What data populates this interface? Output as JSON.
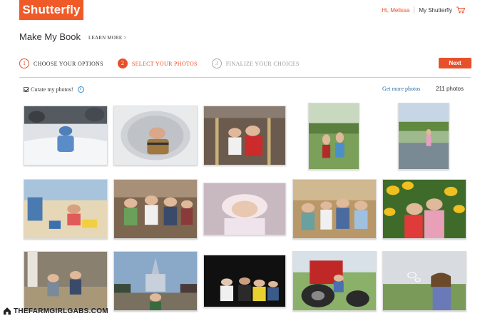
{
  "header": {
    "logo_text": "Shutterfly",
    "greeting": "Hi, Melissa",
    "my_account": "My Shutterfly",
    "cart_icon": "cart-icon",
    "accent_color": "#e8502a"
  },
  "page": {
    "title": "Make My Book",
    "learn_more": "LEARN MORE >"
  },
  "steps": [
    {
      "number": "1",
      "label": "CHOOSE YOUR OPTIONS",
      "state": "done"
    },
    {
      "number": "2",
      "label": "SELECT YOUR PHOTOS",
      "state": "active"
    },
    {
      "number": "3",
      "label": "FINALIZE YOUR CHOICES",
      "state": "future"
    }
  ],
  "next_label": "Next",
  "toolbar": {
    "curate_label": "Curate my photos!",
    "curate_checked": true,
    "info_icon": "i",
    "get_more": "Get more photos",
    "photo_count": "211 photos"
  },
  "photos": [
    {
      "name": "child-in-snow",
      "scene": "snow"
    },
    {
      "name": "child-in-dryer",
      "scene": "dryer"
    },
    {
      "name": "family-at-carousel",
      "scene": "carousel"
    },
    {
      "name": "kids-on-grass",
      "scene": "grass"
    },
    {
      "name": "child-by-pond",
      "scene": "pond"
    },
    {
      "name": "kids-at-beach",
      "scene": "beach"
    },
    {
      "name": "family-indoor-group",
      "scene": "indoor"
    },
    {
      "name": "sleeping-baby",
      "scene": "baby"
    },
    {
      "name": "family-group-living-room",
      "scene": "family"
    },
    {
      "name": "girls-in-sunflowers",
      "scene": "sunflowers"
    },
    {
      "name": "boys-on-porch",
      "scene": "porch"
    },
    {
      "name": "castle-theme-park",
      "scene": "castle"
    },
    {
      "name": "group-at-night",
      "scene": "night"
    },
    {
      "name": "kids-on-tractor",
      "scene": "tractor"
    },
    {
      "name": "girl-blowing-bubbles",
      "scene": "bubbles"
    }
  ],
  "watermark": "THEFARMGIRLGABS.COM"
}
